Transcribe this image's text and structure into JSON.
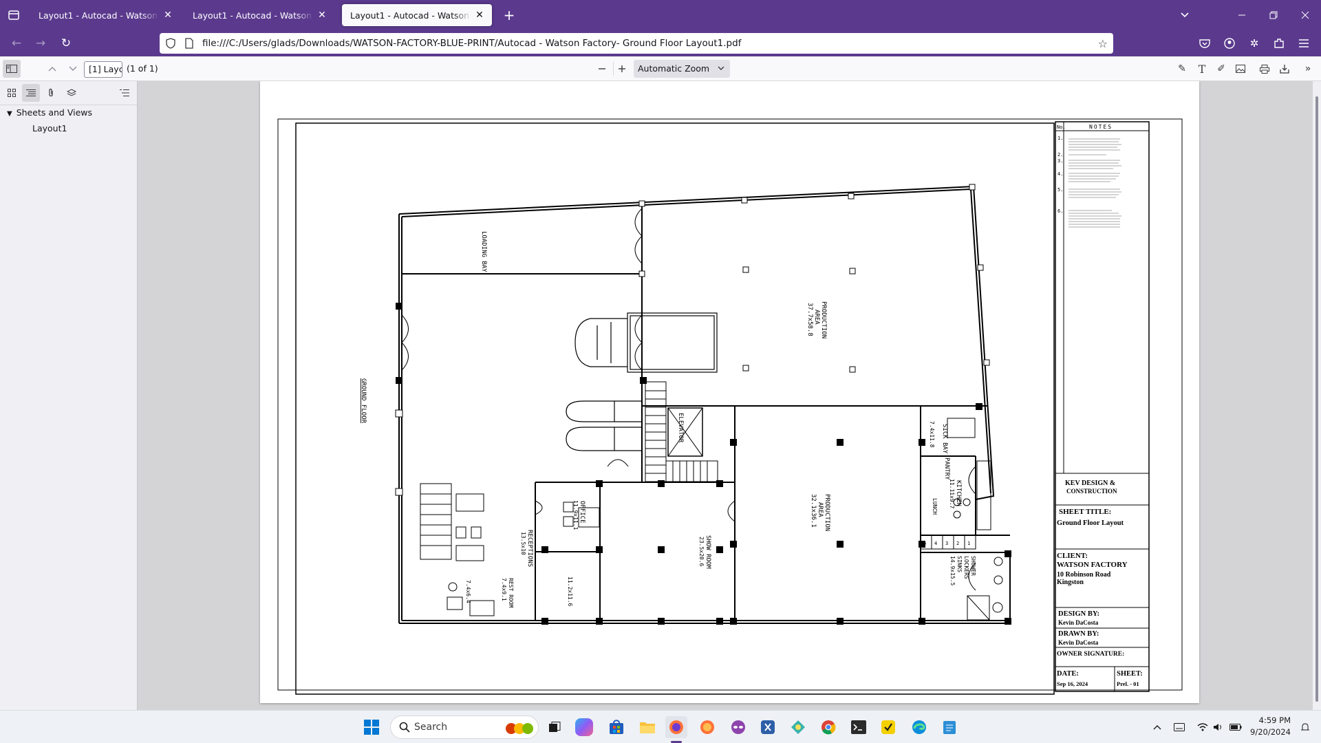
{
  "tabs": [
    {
      "title": "Layout1 - Autocad - Watson Factory",
      "active": false
    },
    {
      "title": "Layout1 - Autocad - Watson Factory",
      "active": false
    },
    {
      "title": "Layout1 - Autocad - Watson Factory",
      "active": true
    }
  ],
  "address_bar": {
    "url": "file:///C:/Users/glads/Downloads/WATSON-FACTORY-BLUE-PRINT/Autocad - Watson Factory- Ground Floor Layout1.pdf"
  },
  "pdf_toolbar": {
    "page_input": "[1] Layc",
    "page_count": "(1 of 1)",
    "zoom": "Automatic Zoom"
  },
  "sidebar": {
    "tree_root": "Sheets and Views",
    "tree_child": "Layout1"
  },
  "drawing": {
    "rooms": {
      "loading_bay": "LOADING BAY",
      "production_area_1": "PRODUCTION",
      "production_area_1b": "AREA",
      "production_area_1_dim": "37.7x58.8",
      "ground_floor": "GROUND FLOOR",
      "elevator": "ELEVATOR",
      "sick_bay": "SICK BAY",
      "sick_bay_dim": "7.4x11.8",
      "pantry": "PANTRY",
      "kitchen": "KITCHEN",
      "kitchen_dim": "11.11x9.7",
      "lunch": "LUNCH",
      "production_area_2": "PRODUCTION",
      "production_area_2b": "AREA",
      "production_area_2_dim": "32.1x36.1",
      "show_room": "SHOW ROOM",
      "show_room_dim": "23.5x20.6",
      "office": "OFFICE",
      "office_dim": "11.9x11.1",
      "receptions": "RECEPTIONS",
      "receptions_dim": "13.5x10",
      "rest_room": "REST ROOM",
      "rest_room_dim": "7.4x9.1",
      "small_dim": "7.4x6.4",
      "hall_dim": "11.2x11.6",
      "shower": "SHOWER",
      "lockers": "LOCKERS",
      "sinks": "SINKS",
      "shower_dim": "14.9x15.5",
      "locker_numbers": [
        "5",
        "4",
        "3",
        "2",
        "1"
      ]
    },
    "notes": {
      "header_no": "No.",
      "header_title": "NOTES",
      "numbers": [
        "1.",
        "2.",
        "3.",
        "4.",
        "5.",
        "6."
      ]
    },
    "title_block": {
      "company": "KEV DESIGN &",
      "company2": "CONSTRUCTION",
      "sheet_title_label": "SHEET TITLE:",
      "sheet_title": "Ground Floor Layout",
      "client_label": "CLIENT:",
      "client_name": "WATSON FACTORY",
      "client_address1": "10 Robinson Road",
      "client_address2": "Kingston",
      "design_by_label": "DESIGN BY:",
      "design_by": "Kevin DaCosta",
      "drawn_by_label": "DRAWN BY:",
      "drawn_by": "Kevin DaCosta",
      "owner_signature_label": "OWNER SIGNATURE:",
      "date_label": "DATE:",
      "date": "Sep 16, 2024",
      "sheet_label": "SHEET:",
      "sheet": "Prel. - 01"
    }
  },
  "taskbar": {
    "search_label": "Search",
    "time": "4:59 PM",
    "date": "9/20/2024"
  }
}
